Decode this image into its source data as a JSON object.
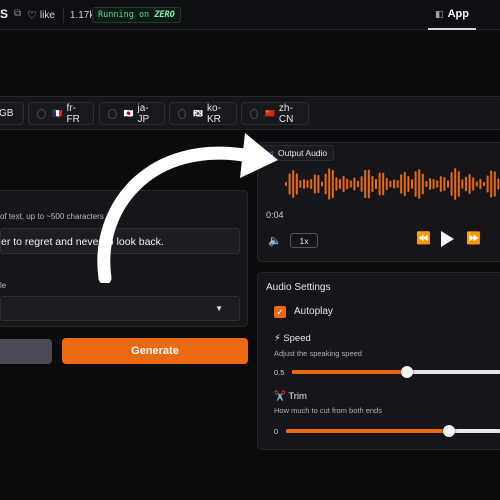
{
  "header": {
    "space_name": "S",
    "like_label": "like",
    "like_count": "1.17k",
    "running_prefix": "Running on",
    "running_hardware": "ZERO",
    "app_tab": "App"
  },
  "languages": [
    {
      "code": "GB",
      "flag": "",
      "selected": false
    },
    {
      "code": "fr-FR",
      "flag": "🇫🇷",
      "selected": false
    },
    {
      "code": "ja-JP",
      "flag": "🇯🇵",
      "selected": false
    },
    {
      "code": "ko-KR",
      "flag": "🇰🇷",
      "selected": false
    },
    {
      "code": "zh-CN",
      "flag": "🇨🇳",
      "selected": false
    }
  ],
  "input": {
    "hint": "of text, up to ~500 characters",
    "text_value": "er to regret and never to look back.",
    "style_label": "le",
    "style_value": ""
  },
  "buttons": {
    "clear": "",
    "generate": "Generate"
  },
  "output": {
    "label": "Output Audio",
    "time": "0:04",
    "playback_rate": "1x",
    "accent_color": "#ea6a12"
  },
  "settings": {
    "title": "Audio Settings",
    "autoplay_label": "Autoplay",
    "autoplay_checked": true,
    "speed_icon": "⚡",
    "speed_label": "Speed",
    "speed_desc": "Adjust the speaking speed",
    "speed_min": "0.5",
    "speed_level": 0.55,
    "trim_icon": "✂️",
    "trim_label": "Trim",
    "trim_desc": "How much to cut from both ends",
    "trim_min": "0",
    "trim_level": 0.76
  }
}
